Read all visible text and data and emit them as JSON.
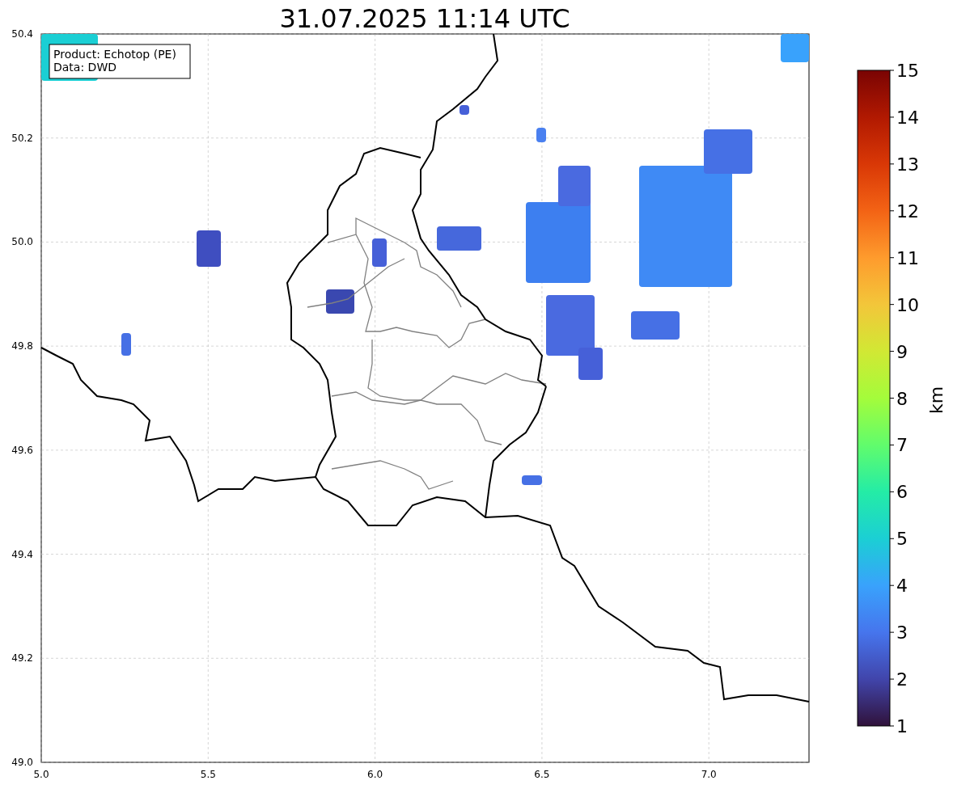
{
  "title": "31.07.2025 11:14 UTC",
  "info_box": [
    "Product: Echotop (PE)",
    "Data: DWD"
  ],
  "map": {
    "xticks": [
      "5.0",
      "5.5",
      "6.0",
      "6.5",
      "7.0"
    ],
    "yticks": [
      "50.4",
      "50.2",
      "50.0",
      "49.8",
      "49.6",
      "49.4",
      "49.2",
      "49.0"
    ]
  },
  "colorbar": {
    "label": "km",
    "ticks": [
      "15",
      "14",
      "13",
      "12",
      "11",
      "10",
      "9",
      "8",
      "7",
      "6",
      "5",
      "4",
      "3",
      "2",
      "1"
    ]
  }
}
